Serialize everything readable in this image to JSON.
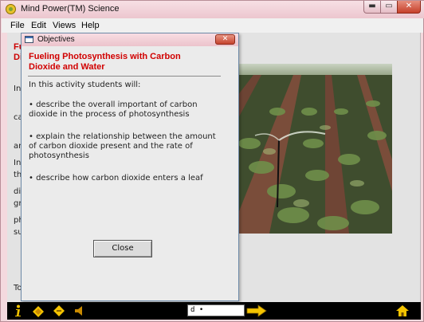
{
  "window": {
    "title": "Mind Power(TM) Science",
    "min_glyph": "▬",
    "max_glyph": "▭",
    "close_glyph": "✕"
  },
  "menu": {
    "items": [
      "File",
      "Edit",
      "Views",
      "Help"
    ]
  },
  "background": {
    "title_lines": [
      "Fu",
      "Di"
    ],
    "para1_lines": [
      "In",
      "ca",
      "an",
      "th",
      "gr",
      "su"
    ],
    "para2_lines": [
      "In",
      "di",
      "ph"
    ],
    "footer_fragment": "To"
  },
  "dialog": {
    "title": "Objectives",
    "close_glyph": "✕",
    "heading": "Fueling Photosynthesis with Carbon Dioxide and Water",
    "intro": "In this activity students will:",
    "bullets": [
      "• describe the overall important of carbon dioxide in the process of photosynthesis",
      "• explain the relationship between the amount of carbon dioxide present and the rate of photosynthesis",
      "• describe how carbon dioxide enters a leaf"
    ],
    "close_label": "Close"
  },
  "toolbar": {
    "page_value": "d  •",
    "icons": [
      "info-icon",
      "previous-page-icon",
      "next-page-icon",
      "speaker-icon",
      "forward-arrow-icon",
      "home-icon"
    ]
  },
  "colors": {
    "heading_red": "#d10000",
    "toolbar_bg": "#000000",
    "icon_yellow": "#f5c400"
  }
}
